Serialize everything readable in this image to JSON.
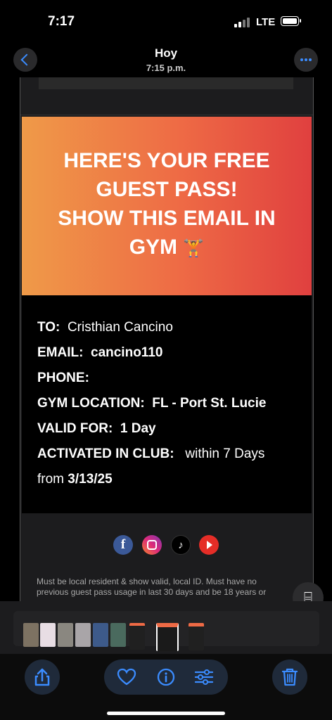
{
  "status_bar": {
    "time": "7:17",
    "network": "LTE"
  },
  "header": {
    "title": "Hoy",
    "subtitle": "7:15 p.m.",
    "back_icon": "chevron-left-icon",
    "more_icon": "ellipsis-icon"
  },
  "email": {
    "banner": {
      "line1": "HERE'S YOUR FREE",
      "line2": "GUEST PASS!",
      "line3": "SHOW THIS EMAIL IN",
      "line4": "GYM",
      "emoji": "🏋"
    },
    "details": {
      "to_label": "TO:",
      "to_value": "Cristhian Cancino",
      "email_label": "EMAIL:",
      "email_value": "cancino110",
      "phone_label": "PHONE:",
      "phone_value": "",
      "location_label": "GYM LOCATION:",
      "location_value": "FL - Port St. Lucie",
      "valid_label": "VALID FOR:",
      "valid_value": "1 Day",
      "activated_label": "ACTIVATED IN CLUB:",
      "activated_value": "within 7 Days",
      "from_label": "from",
      "from_value": "3/13/25"
    },
    "social": {
      "facebook": "f",
      "tiktok": "♪"
    },
    "disclaimer": "Must be local resident & show valid, local ID. Must have no previous guest pass usage in last 30 days and be 18 years or"
  },
  "accent_color": "#3b8cff",
  "banner_colors": [
    "#ef9a48",
    "#e0403f"
  ],
  "toolbar": {
    "share_icon": "share-icon",
    "favorite_icon": "heart-icon",
    "info_icon": "info-icon",
    "adjust_icon": "sliders-icon",
    "delete_icon": "trash-icon"
  }
}
